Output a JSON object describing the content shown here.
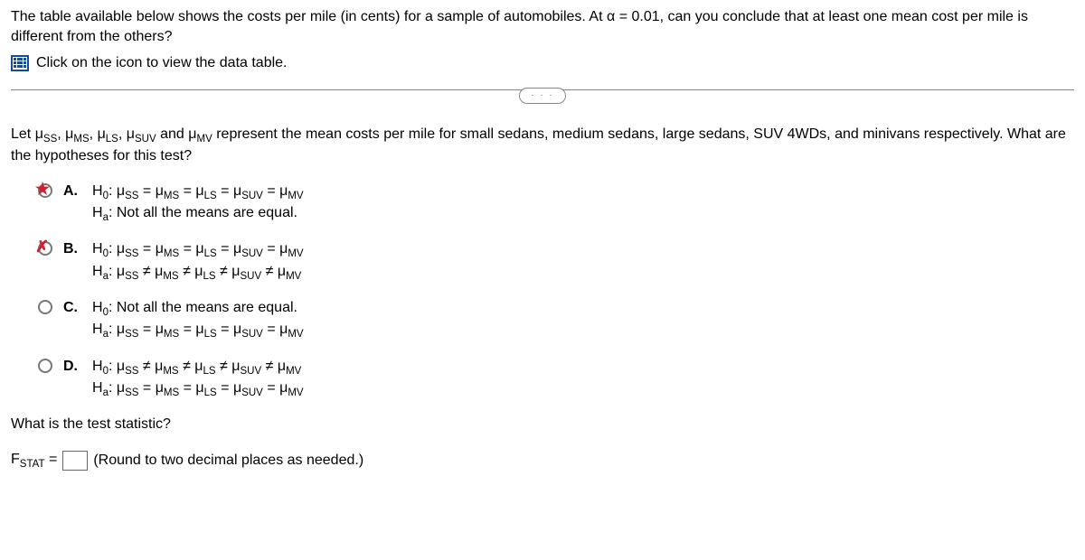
{
  "intro": "The table available below shows the costs per mile (in cents) for a sample of automobiles. At α = 0.01, can you conclude that at least one mean cost per mile is different from the others?",
  "data_link_text": "Click on the icon to view the data table.",
  "collapse_dots": "· · ·",
  "notation_paragraph_prefix": "Let ",
  "notation_mu_list": "μSS, μMS, μLS, μSUV and μMV",
  "notation_paragraph_suffix": " represent the mean costs per mile for small sedans, medium sedans, large sedans, SUV 4WDs, and minivans respectively. What are the hypotheses for this test?",
  "choices": {
    "A": {
      "letter": "A.",
      "h0": "H0: μSS = μMS = μLS = μSUV = μMV",
      "ha": "Ha: Not all the means are equal."
    },
    "B": {
      "letter": "B.",
      "h0": "H0: μSS = μMS = μLS = μSUV = μMV",
      "ha": "Ha: μSS ≠ μMS ≠ μLS ≠ μSUV ≠ μMV"
    },
    "C": {
      "letter": "C.",
      "h0": "H0: Not all the means are equal.",
      "ha": "Ha: μSS = μMS = μLS = μSUV = μMV"
    },
    "D": {
      "letter": "D.",
      "h0": "H0: μSS ≠ μMS ≠ μLS ≠ μSUV ≠ μMV",
      "ha": "Ha: μSS = μMS = μLS = μSUV = μMV"
    }
  },
  "test_stat_question": "What is the test statistic?",
  "fstat_label_prefix": "F",
  "fstat_label_sub": "STAT",
  "fstat_equals": " = ",
  "round_hint": "(Round to two decimal places as needed.)"
}
